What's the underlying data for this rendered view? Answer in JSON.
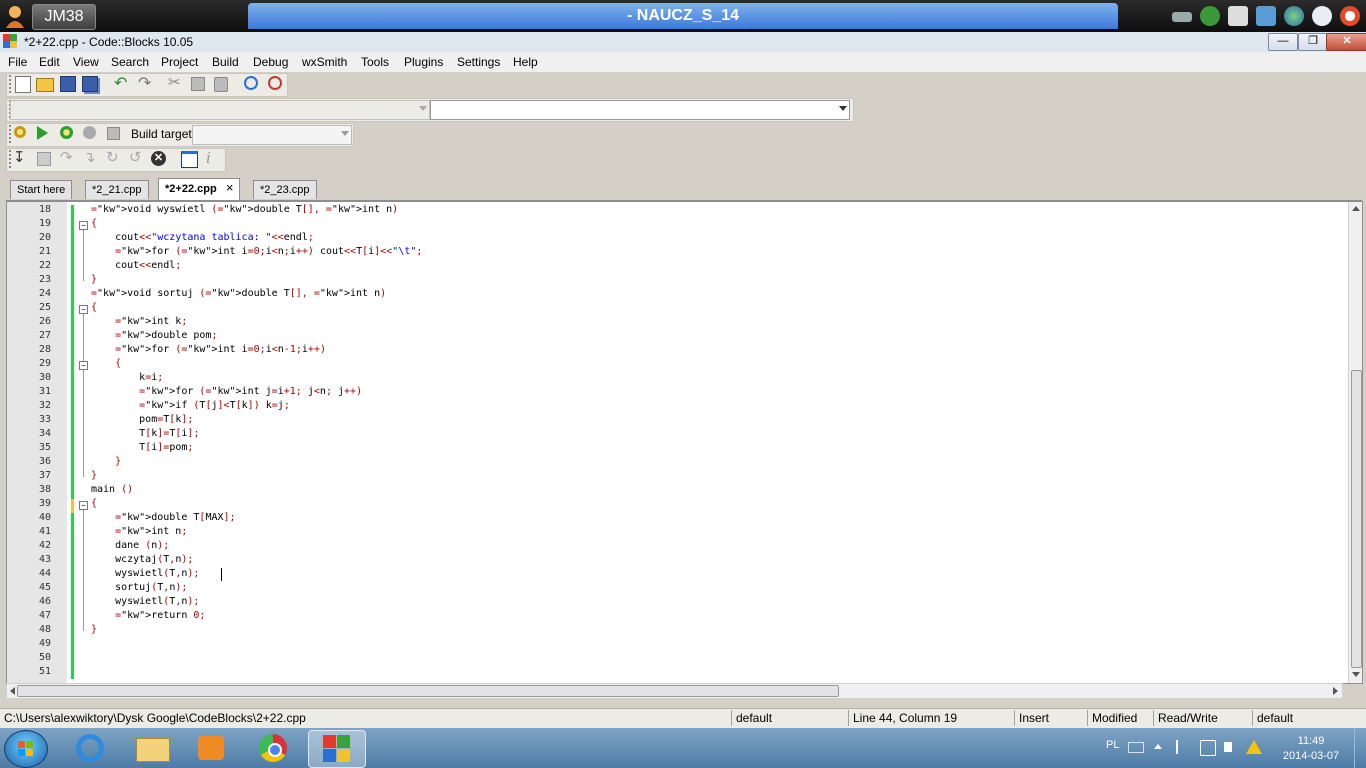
{
  "remote": {
    "host": "JM38",
    "title": "- NAUCZ_S_14"
  },
  "window": {
    "title": "*2+22.cpp - Code::Blocks 10.05"
  },
  "menu": [
    "File",
    "Edit",
    "View",
    "Search",
    "Project",
    "Build",
    "Debug",
    "wxSmith",
    "Tools",
    "Plugins",
    "Settings",
    "Help"
  ],
  "build_toolbar": {
    "build_target_label": "Build target:"
  },
  "tabs": [
    {
      "label": "Start here"
    },
    {
      "label": "*2_21.cpp"
    },
    {
      "label": "*2+22.cpp",
      "close": "×"
    },
    {
      "label": "*2_23.cpp"
    }
  ],
  "editor": {
    "lines": [
      "18",
      "19",
      "20",
      "21",
      "22",
      "23",
      "24",
      "25",
      "26",
      "27",
      "28",
      "29",
      "30",
      "31",
      "32",
      "33",
      "34",
      "35",
      "36",
      "37",
      "38",
      "39",
      "40",
      "41",
      "42",
      "43",
      "44",
      "45",
      "46",
      "47",
      "48",
      "49",
      "50",
      "51"
    ],
    "code": [
      "void wyswietl (double T[], int n)",
      "{",
      "    cout<<\"wczytana tablica: \"<<endl;",
      "    for (int i=0;i<n;i++) cout<<T[i]<<\"\\t\";",
      "    cout<<endl;",
      "}",
      "void sortuj (double T[], int n)",
      "{",
      "    int k;",
      "    double pom;",
      "    for (int i=0;i<n-1;i++)",
      "    {",
      "        k=i;",
      "        for (int j=i+1; j<n; j++)",
      "        if (T[j]<T[k]) k=j;",
      "        pom=T[k];",
      "        T[k]=T[i];",
      "        T[i]=pom;",
      "    }",
      "}",
      "main ()",
      "{",
      "    double T[MAX];",
      "    int n;",
      "    dane (n);",
      "    wczytaj(T,n);",
      "    wyswietl(T,n);",
      "    sortuj(T,n);",
      "    wyswietl(T,n);",
      "    return 0;",
      "}",
      "",
      "",
      ""
    ]
  },
  "statusbar": {
    "path": "C:\\Users\\alexwiktory\\Dysk Google\\CodeBlocks\\2+22.cpp",
    "encoding": "default",
    "position": "Line 44, Column 19",
    "mode": "Insert",
    "modified": "Modified",
    "access": "Read/Write",
    "lang": "default"
  },
  "taskbar": {
    "lang": "PL",
    "time": "11:49",
    "date": "2014-03-07"
  }
}
